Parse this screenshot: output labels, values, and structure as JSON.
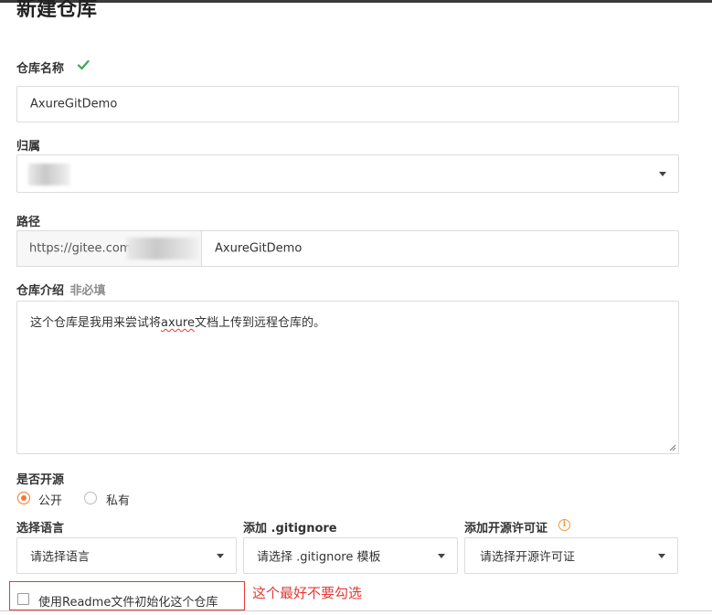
{
  "page": {
    "title": "新建仓库"
  },
  "repo_name": {
    "label": "仓库名称",
    "value": "AxureGitDemo",
    "valid_icon": "check-icon"
  },
  "owner": {
    "label": "归属",
    "value": ""
  },
  "path": {
    "label": "路径",
    "prefix": "https://gitee.com/",
    "value": "AxureGitDemo"
  },
  "description": {
    "label": "仓库介绍",
    "optional_tag": "非必填",
    "value_before": "这个仓库是我用来尝试将",
    "value_misspelled": "axure",
    "value_after": "文档上传到远程仓库的。"
  },
  "visibility": {
    "label": "是否开源",
    "options": [
      {
        "label": "公开",
        "selected": true
      },
      {
        "label": "私有",
        "selected": false
      }
    ]
  },
  "language": {
    "label": "选择语言",
    "value": "请选择语言"
  },
  "gitignore": {
    "label": "添加 .gitignore",
    "value": "请选择 .gitignore 模板"
  },
  "license": {
    "label": "添加开源许可证",
    "value": "请选择开源许可证",
    "info_icon": "info-icon"
  },
  "readme": {
    "label": "使用Readme文件初始化这个仓库",
    "checked": false
  },
  "annotation": {
    "text": "这个最好不要勾选",
    "color": "#e53935"
  },
  "colors": {
    "accent": "#f2782f",
    "valid": "#3aa655",
    "annotation": "#e53935"
  }
}
